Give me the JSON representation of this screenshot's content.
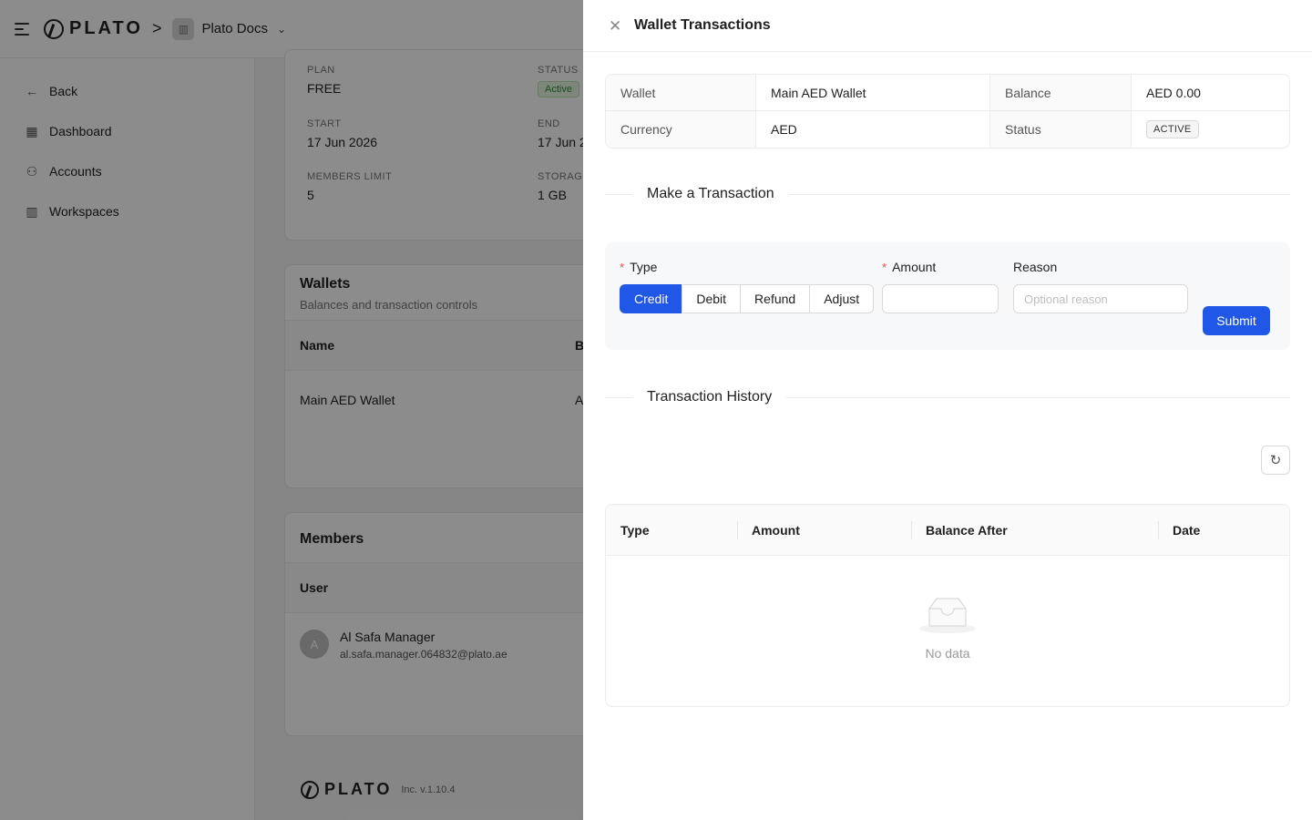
{
  "topbar": {
    "logo_text": "PLATO",
    "breadcrumb_separator": ">",
    "workspace_name": "Plato Docs"
  },
  "sidebar": {
    "items": [
      {
        "label": "Back",
        "icon": "arrow-left-icon"
      },
      {
        "label": "Dashboard",
        "icon": "dashboard-icon"
      },
      {
        "label": "Accounts",
        "icon": "users-icon"
      },
      {
        "label": "Workspaces",
        "icon": "building-icon"
      }
    ]
  },
  "plan_card": {
    "plan_label": "PLAN",
    "plan_value": "FREE",
    "status_label": "STATUS",
    "status_value": "Active",
    "start_label": "START",
    "start_value": "17 Jun 2026",
    "end_label": "END",
    "end_value": "17 Jun 2(",
    "members_limit_label": "MEMBERS LIMIT",
    "members_limit_value": "5",
    "storage_label": "STORAGE",
    "storage_value": "1 GB"
  },
  "wallets_card": {
    "title": "Wallets",
    "subtitle": "Balances and transaction controls",
    "col_name": "Name",
    "col_b": "B",
    "row_name": "Main AED Wallet",
    "row_b": "A"
  },
  "members_card": {
    "title": "Members",
    "col_user": "User",
    "avatar_initial": "A",
    "member_name": "Al Safa Manager",
    "member_email": "al.safa.manager.064832@plato.ae"
  },
  "footer": {
    "logo_text": "PLATO",
    "version": "Inc. v.1.10.4"
  },
  "drawer": {
    "title": "Wallet Transactions",
    "details": {
      "wallet_label": "Wallet",
      "wallet_value": "Main AED Wallet",
      "balance_label": "Balance",
      "balance_value": "AED 0.00",
      "currency_label": "Currency",
      "currency_value": "AED",
      "status_label": "Status",
      "status_value": "ACTIVE"
    },
    "make_transaction": {
      "heading": "Make a Transaction",
      "type_label": "Type",
      "type_options": [
        "Credit",
        "Debit",
        "Refund",
        "Adjust"
      ],
      "selected_type": "Credit",
      "amount_label": "Amount",
      "amount_value": "",
      "reason_label": "Reason",
      "reason_placeholder": "Optional reason",
      "submit_label": "Submit"
    },
    "history": {
      "heading": "Transaction History",
      "columns": [
        "Type",
        "Amount",
        "Balance After",
        "Date"
      ],
      "empty_text": "No data"
    }
  },
  "colors": {
    "primary": "#2157e6",
    "required": "#ff4d4f",
    "active_green": "#2e8a2e",
    "mask": "rgba(0,0,0,0.45)"
  }
}
